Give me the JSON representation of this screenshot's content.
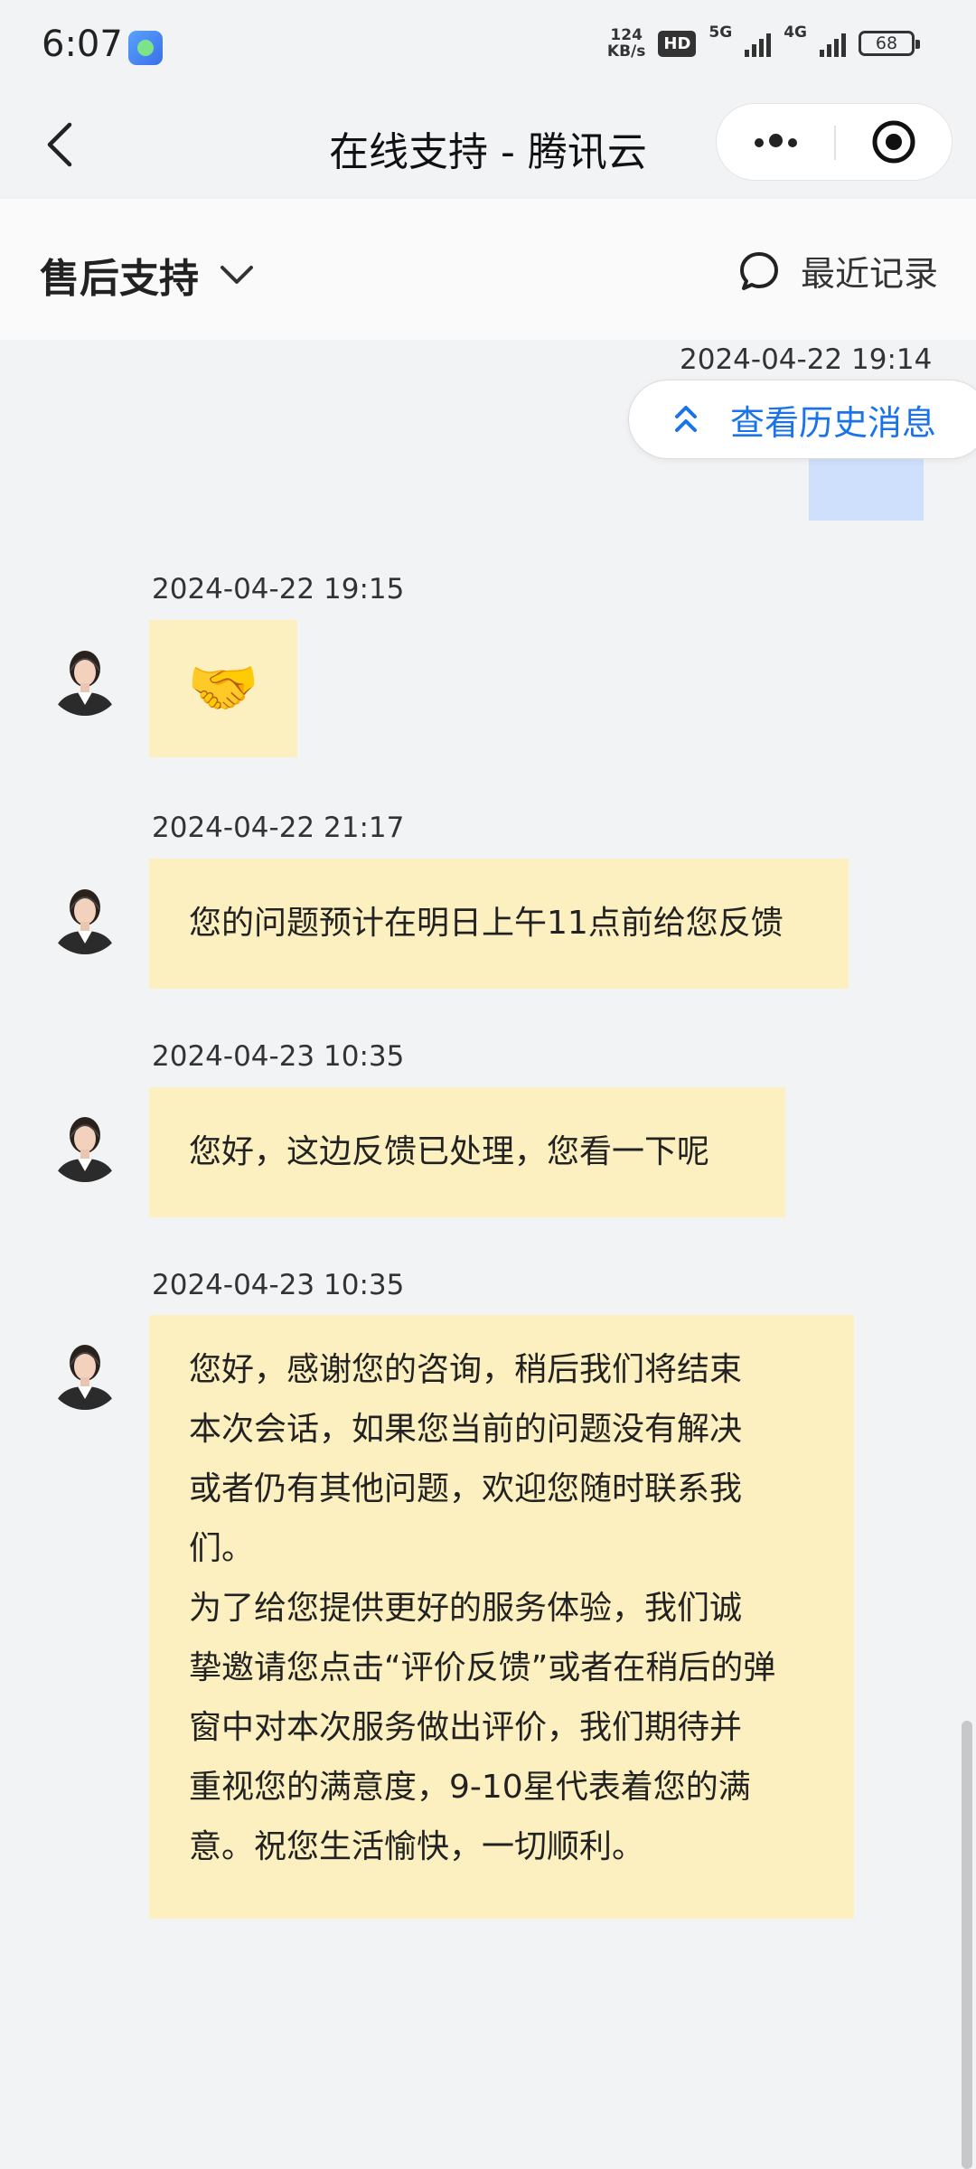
{
  "status_bar": {
    "time": "6:07",
    "net_speed_value": "124",
    "net_speed_unit": "KB/s",
    "hd_badge": "HD",
    "net_type_1": "5G",
    "net_type_2": "4G",
    "battery": "68"
  },
  "nav": {
    "title": "在线支持 - 腾讯云",
    "back_icon": "chevron-left-icon",
    "more_icon": "more-dots-icon",
    "close_icon": "target-circle-icon"
  },
  "subheader": {
    "department": "售后支持",
    "recent_label": "最近记录"
  },
  "history_button": {
    "label": "查看历史消息"
  },
  "messages": [
    {
      "sender": "user",
      "time": "2024-04-22 19:14",
      "text": ""
    },
    {
      "sender": "agent",
      "time": "2024-04-22 19:15",
      "text": "🤝"
    },
    {
      "sender": "agent",
      "time": "2024-04-22 21:17",
      "text": "您的问题预计在明日上午11点前给您反馈"
    },
    {
      "sender": "agent",
      "time": "2024-04-23 10:35",
      "text": "您好，这边反馈已处理，您看一下呢"
    },
    {
      "sender": "agent",
      "time": "2024-04-23 10:35",
      "lines": [
        "您好，感谢您的咨询，稍后我们将结束",
        "本次会话，如果您当前的问题没有解决",
        "或者仍有其他问题，欢迎您随时联系我",
        "们。",
        "为了给您提供更好的服务体验，我们诚",
        "挚邀请您点击“评价反馈”或者在稍后的弹",
        "窗中对本次服务做出评价，我们期待并",
        "重视您的满意度，9-10星代表着您的满",
        "意。祝您生活愉快，一切顺利。"
      ]
    }
  ],
  "colors": {
    "agent_bubble": "#fdf0c0",
    "user_bubble": "#cfe0fc",
    "link": "#1a73e8",
    "background": "#f2f3f5"
  }
}
